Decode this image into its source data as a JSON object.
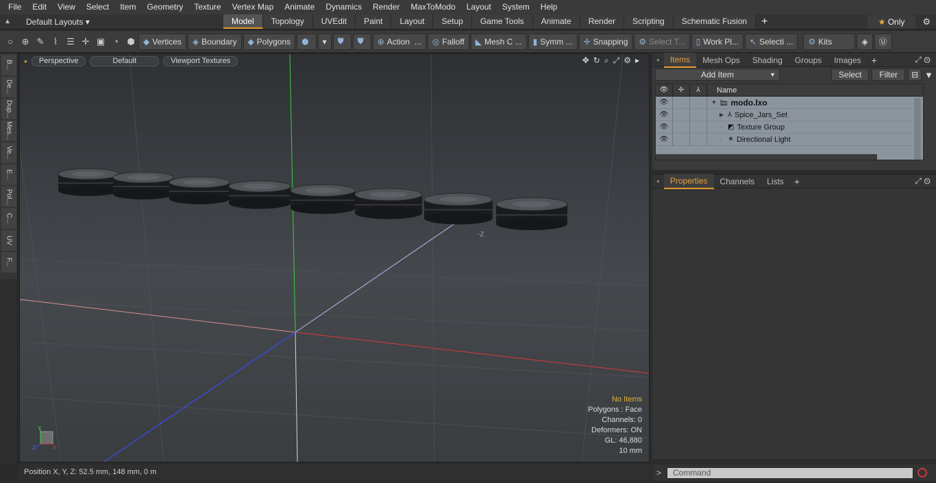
{
  "menu": [
    "File",
    "Edit",
    "View",
    "Select",
    "Item",
    "Geometry",
    "Texture",
    "Vertex Map",
    "Animate",
    "Dynamics",
    "Render",
    "MaxToModo",
    "Layout",
    "System",
    "Help"
  ],
  "layouts_label": "Default Layouts",
  "tabs": [
    {
      "label": "Model",
      "active": true
    },
    {
      "label": "Topology",
      "active": false
    },
    {
      "label": "UVEdit",
      "active": false
    },
    {
      "label": "Paint",
      "active": false
    },
    {
      "label": "Layout",
      "active": false
    },
    {
      "label": "Setup",
      "active": false
    },
    {
      "label": "Game Tools",
      "active": false
    },
    {
      "label": "Animate",
      "active": false
    },
    {
      "label": "Render",
      "active": false
    },
    {
      "label": "Scripting",
      "active": false
    },
    {
      "label": "Schematic Fusion",
      "active": false
    }
  ],
  "only_label": "Only",
  "toolbar": {
    "vertices": "Vertices",
    "boundary": "Boundary",
    "polygons": "Polygons",
    "action": "Action",
    "falloff": "Falloff",
    "mesh": "Mesh C ...",
    "symm": "Symm ...",
    "snapping": "Snapping",
    "select_t": "Select T...",
    "work_pl": "Work Pl...",
    "selecti": "Selecti ...",
    "kits": "Kits"
  },
  "left_tabs": [
    "B...",
    "De...",
    "Dup...",
    "Mes...",
    "Ve...",
    "E...",
    "Pol...",
    "C...",
    "UV",
    "F..."
  ],
  "viewport": {
    "view_mode": "Perspective",
    "shading": "Default",
    "textures": "Viewport Textures",
    "axis_label_z": "-Z",
    "stats": {
      "selection": "No Items",
      "polygons": "Polygons : Face",
      "channels": "Channels: 0",
      "deformers": "Deformers: ON",
      "gl": "GL: 46,880",
      "unit": "10 mm"
    }
  },
  "status": "Position X, Y, Z:   52.5 mm, 148 mm, 0 m",
  "items_panel": {
    "tabs": [
      {
        "label": "Items",
        "active": true
      },
      {
        "label": "Mesh Ops",
        "active": false
      },
      {
        "label": "Shading",
        "active": false
      },
      {
        "label": "Groups",
        "active": false
      },
      {
        "label": "Images",
        "active": false
      }
    ],
    "add_item": "Add Item",
    "select": "Select",
    "filter": "Filter",
    "name_header": "Name",
    "tree": [
      {
        "label": "modo.lxo",
        "bold": true,
        "indent": 0,
        "expander": "▼",
        "icon": "scene"
      },
      {
        "label": "Spice_Jars_Set",
        "bold": false,
        "indent": 1,
        "expander": "▶",
        "icon": "mesh"
      },
      {
        "label": "Texture Group",
        "bold": false,
        "indent": 1,
        "expander": "",
        "icon": "texture"
      },
      {
        "label": "Directional Light",
        "bold": false,
        "indent": 1,
        "expander": "",
        "icon": "light"
      }
    ]
  },
  "props_panel": {
    "tabs": [
      {
        "label": "Properties",
        "active": true
      },
      {
        "label": "Channels",
        "active": false
      },
      {
        "label": "Lists",
        "active": false
      }
    ]
  },
  "command": {
    "placeholder": "Command"
  }
}
